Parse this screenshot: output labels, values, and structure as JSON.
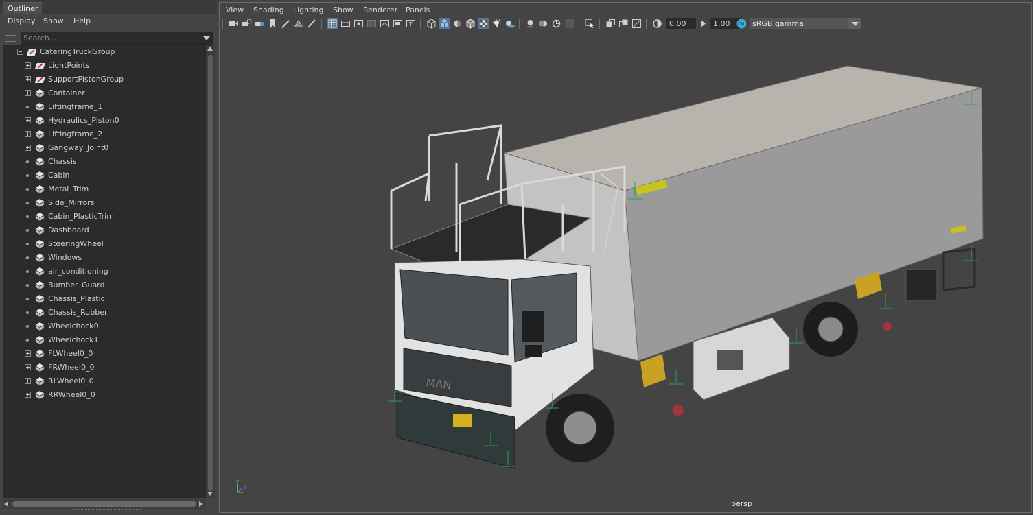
{
  "outliner": {
    "tab_title": "Outliner",
    "menu": [
      "Display",
      "Show",
      "Help"
    ],
    "search_placeholder": "Search...",
    "root": {
      "label": "CateringTruckGroup",
      "icon": "group-icon",
      "expanded": true
    },
    "items": [
      {
        "label": "LightPoints",
        "icon": "group-icon",
        "expandable": true
      },
      {
        "label": "SupportPistonGroup",
        "icon": "group-icon",
        "expandable": true
      },
      {
        "label": "Container",
        "icon": "mesh-icon",
        "expandable": true
      },
      {
        "label": "Liftingframe_1",
        "icon": "mesh-icon",
        "expandable": false
      },
      {
        "label": "Hydraulics_Piston0",
        "icon": "mesh-icon",
        "expandable": true
      },
      {
        "label": "Liftingframe_2",
        "icon": "mesh-icon",
        "expandable": true
      },
      {
        "label": "Gangway_Joint0",
        "icon": "mesh-icon",
        "expandable": true
      },
      {
        "label": "Chassis",
        "icon": "mesh-icon",
        "expandable": false
      },
      {
        "label": "Cabin",
        "icon": "mesh-icon",
        "expandable": false
      },
      {
        "label": "Metal_Trim",
        "icon": "mesh-icon",
        "expandable": false
      },
      {
        "label": "Side_Mirrors",
        "icon": "mesh-icon",
        "expandable": false
      },
      {
        "label": "Cabin_PlasticTrim",
        "icon": "mesh-icon",
        "expandable": false
      },
      {
        "label": "Dashboard",
        "icon": "mesh-icon",
        "expandable": false
      },
      {
        "label": "SteeringWheel",
        "icon": "mesh-icon",
        "expandable": false
      },
      {
        "label": "Windows",
        "icon": "mesh-icon",
        "expandable": false
      },
      {
        "label": "air_conditioning",
        "icon": "mesh-icon",
        "expandable": false
      },
      {
        "label": "Bumber_Guard",
        "icon": "mesh-icon",
        "expandable": false
      },
      {
        "label": "Chassis_Plastic",
        "icon": "mesh-icon",
        "expandable": false
      },
      {
        "label": "Chassis_Rubber",
        "icon": "mesh-icon",
        "expandable": false
      },
      {
        "label": "Wheelchock0",
        "icon": "mesh-icon",
        "expandable": false
      },
      {
        "label": "Wheelchock1",
        "icon": "mesh-icon",
        "expandable": false
      },
      {
        "label": "FLWheel0_0",
        "icon": "mesh-icon",
        "expandable": true
      },
      {
        "label": "FRWheel0_0",
        "icon": "mesh-icon",
        "expandable": true
      },
      {
        "label": "RLWheel0_0",
        "icon": "mesh-icon",
        "expandable": true
      },
      {
        "label": "RRWheel0_0",
        "icon": "mesh-icon",
        "expandable": true
      }
    ]
  },
  "viewport": {
    "menu": [
      "View",
      "Shading",
      "Lighting",
      "Show",
      "Renderer",
      "Panels"
    ],
    "exposure": "0.00",
    "gamma": "1.00",
    "color_space": "sRGB gamma",
    "camera_label": "persp",
    "axis_labels": {
      "x": "x",
      "y": "y",
      "z": "z"
    }
  },
  "colors": {
    "accent": "#5a7391",
    "panel_bg": "#444444",
    "field_bg": "#2b2b2b",
    "truck_body": "#c9c9c9",
    "truck_cab": "#e6e6e6"
  }
}
